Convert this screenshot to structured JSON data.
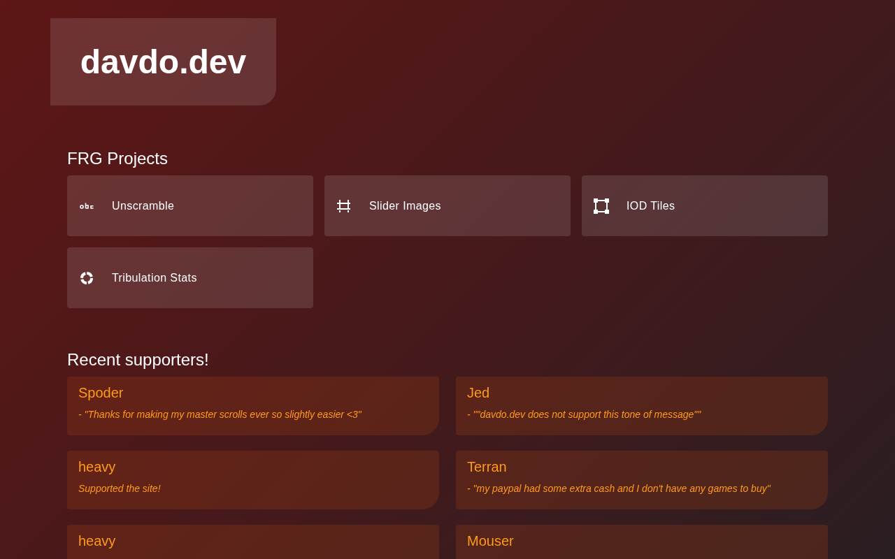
{
  "logo": "davdo.dev",
  "projects_heading": "FRG Projects",
  "projects": [
    {
      "label": "Unscramble",
      "kind": "abc"
    },
    {
      "label": "Slider Images",
      "kind": "frame"
    },
    {
      "label": "IOD Tiles",
      "kind": "tiles"
    },
    {
      "label": "Tribulation Stats",
      "kind": "donut"
    }
  ],
  "supporters_heading": "Recent supporters!",
  "supporters": [
    {
      "name": "Spoder",
      "message": "- \"Thanks for making my master scrolls ever so slightly easier <3\""
    },
    {
      "name": "Jed",
      "message": "- \"\"davdo.dev does not support this tone of message\"\""
    },
    {
      "name": "heavy",
      "message": "Supported the site!"
    },
    {
      "name": "Terran",
      "message": "- \"my paypal had some extra cash and I don't have any games to buy\""
    },
    {
      "name": "heavy"
    },
    {
      "name": "Mouser"
    }
  ]
}
